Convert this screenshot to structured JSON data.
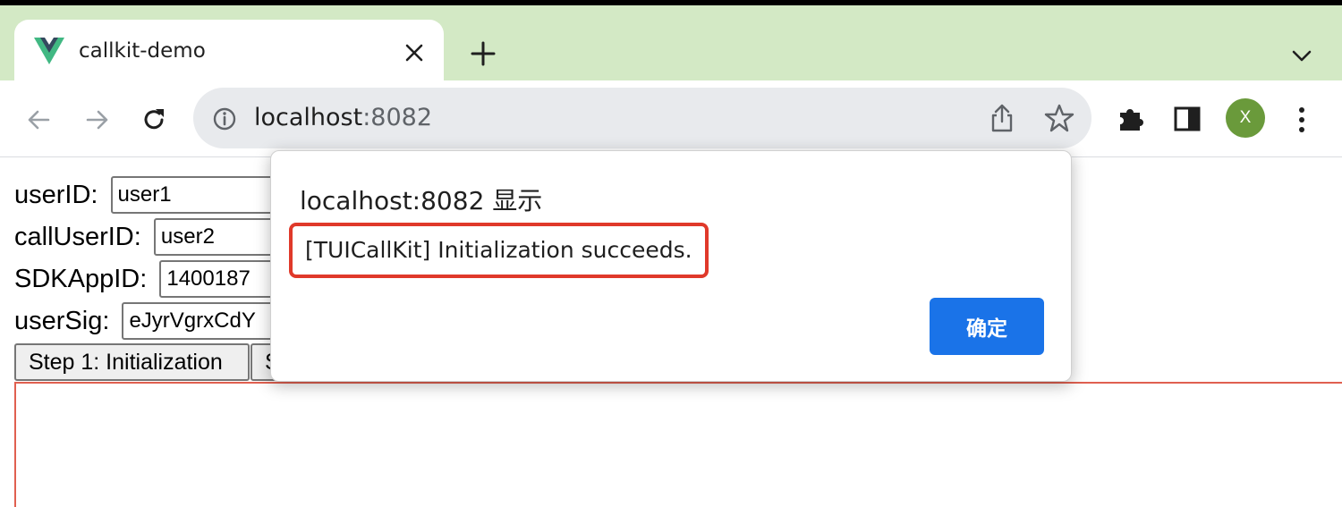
{
  "browser": {
    "tab": {
      "title": "callkit-demo"
    },
    "address": {
      "host": "localhost",
      "port": ":8082"
    },
    "profile_initial": "X"
  },
  "form": {
    "user_id_label": "userID:",
    "user_id_value": "user1",
    "call_user_id_label": "callUserID:",
    "call_user_id_value": "user2",
    "sdk_app_id_label": "SDKAppID:",
    "sdk_app_id_value": "1400187",
    "user_sig_label": "userSig:",
    "user_sig_value": "eJyrVgrxCdY",
    "step1_label": "Step 1: Initialization",
    "step2_label": "S"
  },
  "dialog": {
    "title": "localhost:8082 显示",
    "message": "[TUICallKit] Initialization succeeds.",
    "ok_label": "确定"
  },
  "colors": {
    "tabstrip": "#d3e9c5",
    "accent": "#1a73e8",
    "highlight_box": "#e0392a",
    "avatar": "#6a9a3b"
  }
}
